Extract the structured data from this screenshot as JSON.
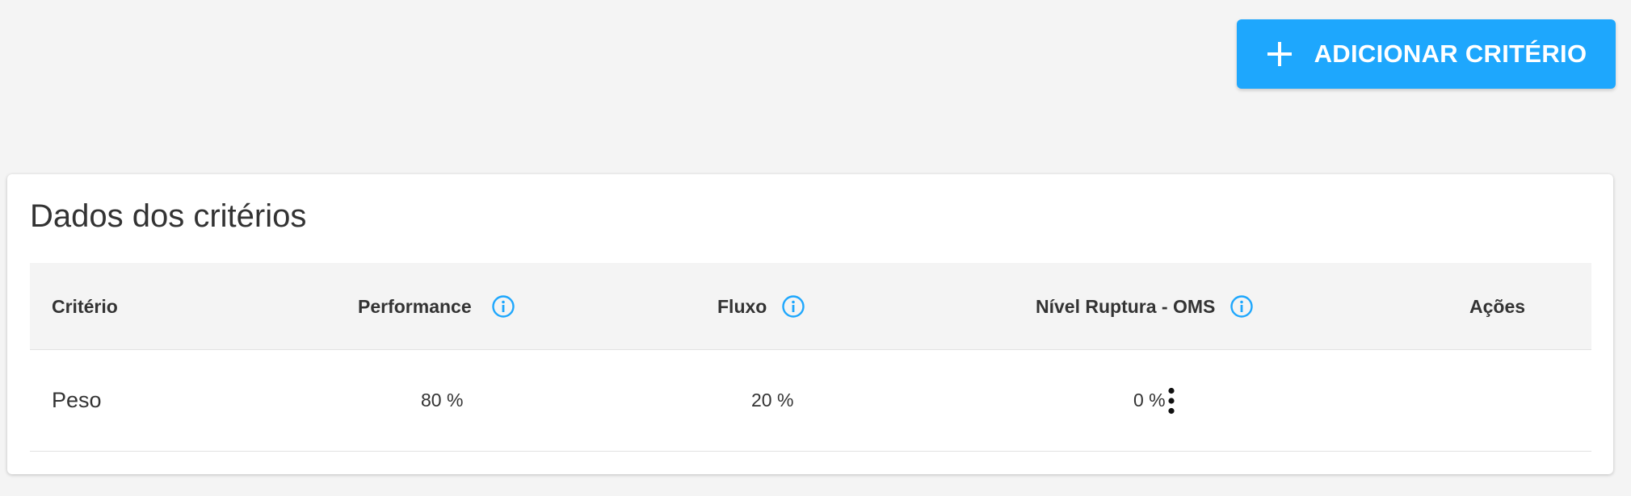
{
  "header": {
    "add_button_label": "ADICIONAR CRITÉRIO"
  },
  "card": {
    "title": "Dados dos critérios",
    "columns": {
      "criterio": "Critério",
      "performance": "Performance",
      "fluxo": "Fluxo",
      "nivel_ruptura": "Nível Ruptura - OMS",
      "acoes": "Ações"
    },
    "rows": [
      {
        "name": "Peso",
        "performance": "80 %",
        "fluxo": "20 %",
        "nivel_ruptura": "0 %"
      }
    ]
  },
  "colors": {
    "accent": "#1ea7fd",
    "info_icon": "#1ea7fd"
  },
  "icons": {
    "add": "plus-icon",
    "info": "info-circle-icon",
    "actions": "more-vertical-icon"
  }
}
